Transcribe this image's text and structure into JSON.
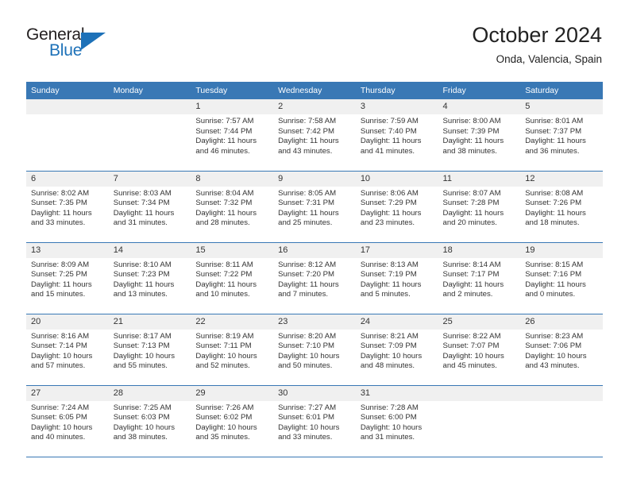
{
  "logo": {
    "word_top": "General",
    "word_bottom": "Blue",
    "icon": "triangle-flag-icon",
    "accent_color": "#1d71b8"
  },
  "header": {
    "title": "October 2024",
    "subtitle": "Onda, Valencia, Spain"
  },
  "theme": {
    "header_row_bg": "#3978b5",
    "header_row_text": "#ffffff",
    "daynum_bg": "#f0f0f0",
    "grid_line": "#3978b5",
    "body_text": "#333333"
  },
  "weekdays": [
    "Sunday",
    "Monday",
    "Tuesday",
    "Wednesday",
    "Thursday",
    "Friday",
    "Saturday"
  ],
  "weeks": [
    [
      {
        "day": "",
        "sunrise": "",
        "sunset": "",
        "daylight": ""
      },
      {
        "day": "",
        "sunrise": "",
        "sunset": "",
        "daylight": ""
      },
      {
        "day": "1",
        "sunrise": "Sunrise: 7:57 AM",
        "sunset": "Sunset: 7:44 PM",
        "daylight": "Daylight: 11 hours and 46 minutes."
      },
      {
        "day": "2",
        "sunrise": "Sunrise: 7:58 AM",
        "sunset": "Sunset: 7:42 PM",
        "daylight": "Daylight: 11 hours and 43 minutes."
      },
      {
        "day": "3",
        "sunrise": "Sunrise: 7:59 AM",
        "sunset": "Sunset: 7:40 PM",
        "daylight": "Daylight: 11 hours and 41 minutes."
      },
      {
        "day": "4",
        "sunrise": "Sunrise: 8:00 AM",
        "sunset": "Sunset: 7:39 PM",
        "daylight": "Daylight: 11 hours and 38 minutes."
      },
      {
        "day": "5",
        "sunrise": "Sunrise: 8:01 AM",
        "sunset": "Sunset: 7:37 PM",
        "daylight": "Daylight: 11 hours and 36 minutes."
      }
    ],
    [
      {
        "day": "6",
        "sunrise": "Sunrise: 8:02 AM",
        "sunset": "Sunset: 7:35 PM",
        "daylight": "Daylight: 11 hours and 33 minutes."
      },
      {
        "day": "7",
        "sunrise": "Sunrise: 8:03 AM",
        "sunset": "Sunset: 7:34 PM",
        "daylight": "Daylight: 11 hours and 31 minutes."
      },
      {
        "day": "8",
        "sunrise": "Sunrise: 8:04 AM",
        "sunset": "Sunset: 7:32 PM",
        "daylight": "Daylight: 11 hours and 28 minutes."
      },
      {
        "day": "9",
        "sunrise": "Sunrise: 8:05 AM",
        "sunset": "Sunset: 7:31 PM",
        "daylight": "Daylight: 11 hours and 25 minutes."
      },
      {
        "day": "10",
        "sunrise": "Sunrise: 8:06 AM",
        "sunset": "Sunset: 7:29 PM",
        "daylight": "Daylight: 11 hours and 23 minutes."
      },
      {
        "day": "11",
        "sunrise": "Sunrise: 8:07 AM",
        "sunset": "Sunset: 7:28 PM",
        "daylight": "Daylight: 11 hours and 20 minutes."
      },
      {
        "day": "12",
        "sunrise": "Sunrise: 8:08 AM",
        "sunset": "Sunset: 7:26 PM",
        "daylight": "Daylight: 11 hours and 18 minutes."
      }
    ],
    [
      {
        "day": "13",
        "sunrise": "Sunrise: 8:09 AM",
        "sunset": "Sunset: 7:25 PM",
        "daylight": "Daylight: 11 hours and 15 minutes."
      },
      {
        "day": "14",
        "sunrise": "Sunrise: 8:10 AM",
        "sunset": "Sunset: 7:23 PM",
        "daylight": "Daylight: 11 hours and 13 minutes."
      },
      {
        "day": "15",
        "sunrise": "Sunrise: 8:11 AM",
        "sunset": "Sunset: 7:22 PM",
        "daylight": "Daylight: 11 hours and 10 minutes."
      },
      {
        "day": "16",
        "sunrise": "Sunrise: 8:12 AM",
        "sunset": "Sunset: 7:20 PM",
        "daylight": "Daylight: 11 hours and 7 minutes."
      },
      {
        "day": "17",
        "sunrise": "Sunrise: 8:13 AM",
        "sunset": "Sunset: 7:19 PM",
        "daylight": "Daylight: 11 hours and 5 minutes."
      },
      {
        "day": "18",
        "sunrise": "Sunrise: 8:14 AM",
        "sunset": "Sunset: 7:17 PM",
        "daylight": "Daylight: 11 hours and 2 minutes."
      },
      {
        "day": "19",
        "sunrise": "Sunrise: 8:15 AM",
        "sunset": "Sunset: 7:16 PM",
        "daylight": "Daylight: 11 hours and 0 minutes."
      }
    ],
    [
      {
        "day": "20",
        "sunrise": "Sunrise: 8:16 AM",
        "sunset": "Sunset: 7:14 PM",
        "daylight": "Daylight: 10 hours and 57 minutes."
      },
      {
        "day": "21",
        "sunrise": "Sunrise: 8:17 AM",
        "sunset": "Sunset: 7:13 PM",
        "daylight": "Daylight: 10 hours and 55 minutes."
      },
      {
        "day": "22",
        "sunrise": "Sunrise: 8:19 AM",
        "sunset": "Sunset: 7:11 PM",
        "daylight": "Daylight: 10 hours and 52 minutes."
      },
      {
        "day": "23",
        "sunrise": "Sunrise: 8:20 AM",
        "sunset": "Sunset: 7:10 PM",
        "daylight": "Daylight: 10 hours and 50 minutes."
      },
      {
        "day": "24",
        "sunrise": "Sunrise: 8:21 AM",
        "sunset": "Sunset: 7:09 PM",
        "daylight": "Daylight: 10 hours and 48 minutes."
      },
      {
        "day": "25",
        "sunrise": "Sunrise: 8:22 AM",
        "sunset": "Sunset: 7:07 PM",
        "daylight": "Daylight: 10 hours and 45 minutes."
      },
      {
        "day": "26",
        "sunrise": "Sunrise: 8:23 AM",
        "sunset": "Sunset: 7:06 PM",
        "daylight": "Daylight: 10 hours and 43 minutes."
      }
    ],
    [
      {
        "day": "27",
        "sunrise": "Sunrise: 7:24 AM",
        "sunset": "Sunset: 6:05 PM",
        "daylight": "Daylight: 10 hours and 40 minutes."
      },
      {
        "day": "28",
        "sunrise": "Sunrise: 7:25 AM",
        "sunset": "Sunset: 6:03 PM",
        "daylight": "Daylight: 10 hours and 38 minutes."
      },
      {
        "day": "29",
        "sunrise": "Sunrise: 7:26 AM",
        "sunset": "Sunset: 6:02 PM",
        "daylight": "Daylight: 10 hours and 35 minutes."
      },
      {
        "day": "30",
        "sunrise": "Sunrise: 7:27 AM",
        "sunset": "Sunset: 6:01 PM",
        "daylight": "Daylight: 10 hours and 33 minutes."
      },
      {
        "day": "31",
        "sunrise": "Sunrise: 7:28 AM",
        "sunset": "Sunset: 6:00 PM",
        "daylight": "Daylight: 10 hours and 31 minutes."
      },
      {
        "day": "",
        "sunrise": "",
        "sunset": "",
        "daylight": ""
      },
      {
        "day": "",
        "sunrise": "",
        "sunset": "",
        "daylight": ""
      }
    ]
  ]
}
